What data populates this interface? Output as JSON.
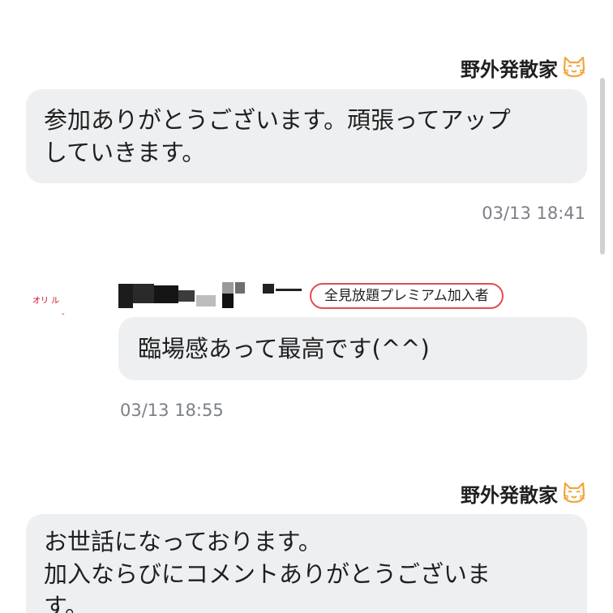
{
  "messages": [
    {
      "sender": "野外発散家",
      "sender_icon": "cat-face-icon",
      "text": "参加ありがとうございます。頑張ってアップ\nしていきます。",
      "time": "03/13 18:41"
    },
    {
      "avatar_text": "オリ ル",
      "badge": "全見放題プレミアム加入者",
      "badge_color": "#e44b55",
      "text": "臨場感あって最高です(^^)",
      "time": "03/13 18:55"
    },
    {
      "sender": "野外発散家",
      "sender_icon": "cat-face-icon",
      "text": "お世話になっております。\n加入ならびにコメントありがとうございま\nす。"
    }
  ],
  "colors": {
    "bubble_bg": "#eeeff1",
    "timestamp": "#7b7f86",
    "cat_icon": "#f0a63a"
  }
}
